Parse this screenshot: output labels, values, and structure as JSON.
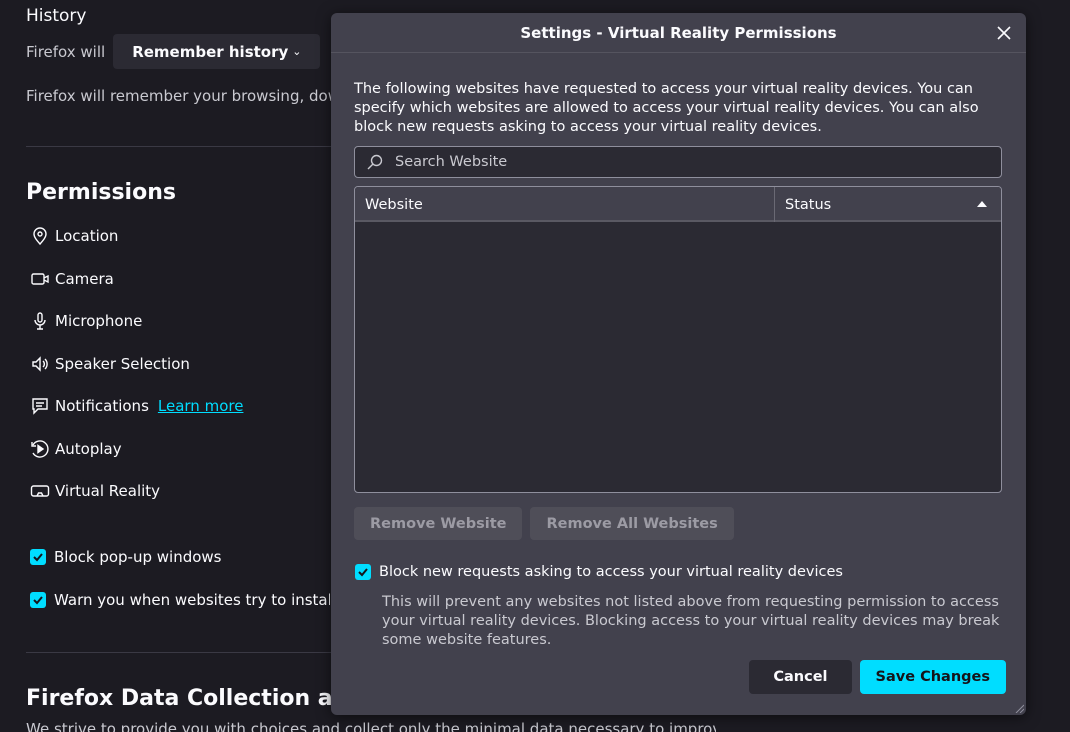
{
  "background": {
    "history_title": "History",
    "history_label": "Firefox will",
    "history_dropdown": "Remember history",
    "history_desc": "Firefox will remember your browsing, downloa",
    "permissions_title": "Permissions",
    "permissions": [
      {
        "label": "Location",
        "icon": "location-pin-icon"
      },
      {
        "label": "Camera",
        "icon": "camera-icon"
      },
      {
        "label": "Microphone",
        "icon": "microphone-icon"
      },
      {
        "label": "Speaker Selection",
        "icon": "speaker-icon"
      },
      {
        "label": "Notifications",
        "icon": "notification-icon"
      },
      {
        "label": "Autoplay",
        "icon": "autoplay-icon"
      },
      {
        "label": "Virtual Reality",
        "icon": "vr-headset-icon"
      }
    ],
    "learn_more": "Learn more",
    "block_popups": "Block pop-up windows",
    "warn_addons": "Warn you when websites try to install add",
    "data_collection_title": "Firefox Data Collection and Us",
    "data_collection_text": "We strive to provide you with choices and collect only the minimal data necessary to improve Firefox."
  },
  "dialog": {
    "title": "Settings - Virtual Reality Permissions",
    "description": "The following websites have requested to access your virtual reality devices. You can specify which websites are allowed to access your virtual reality devices. You can also block new requests asking to access your virtual reality devices.",
    "search_placeholder": "Search Website",
    "columns": {
      "website": "Website",
      "status": "Status"
    },
    "rows": [],
    "remove_website": "Remove Website",
    "remove_all_websites": "Remove All Websites",
    "block_new_label": "Block new requests asking to access your virtual reality devices",
    "block_new_checked": true,
    "help_text": "This will prevent any websites not listed above from requesting permission to access your virtual reality devices. Blocking access to your virtual reality devices may break some website features.",
    "cancel": "Cancel",
    "save": "Save Changes"
  },
  "colors": {
    "accent": "#00ddff",
    "background": "#1c1b22",
    "dialog": "#42414d"
  }
}
